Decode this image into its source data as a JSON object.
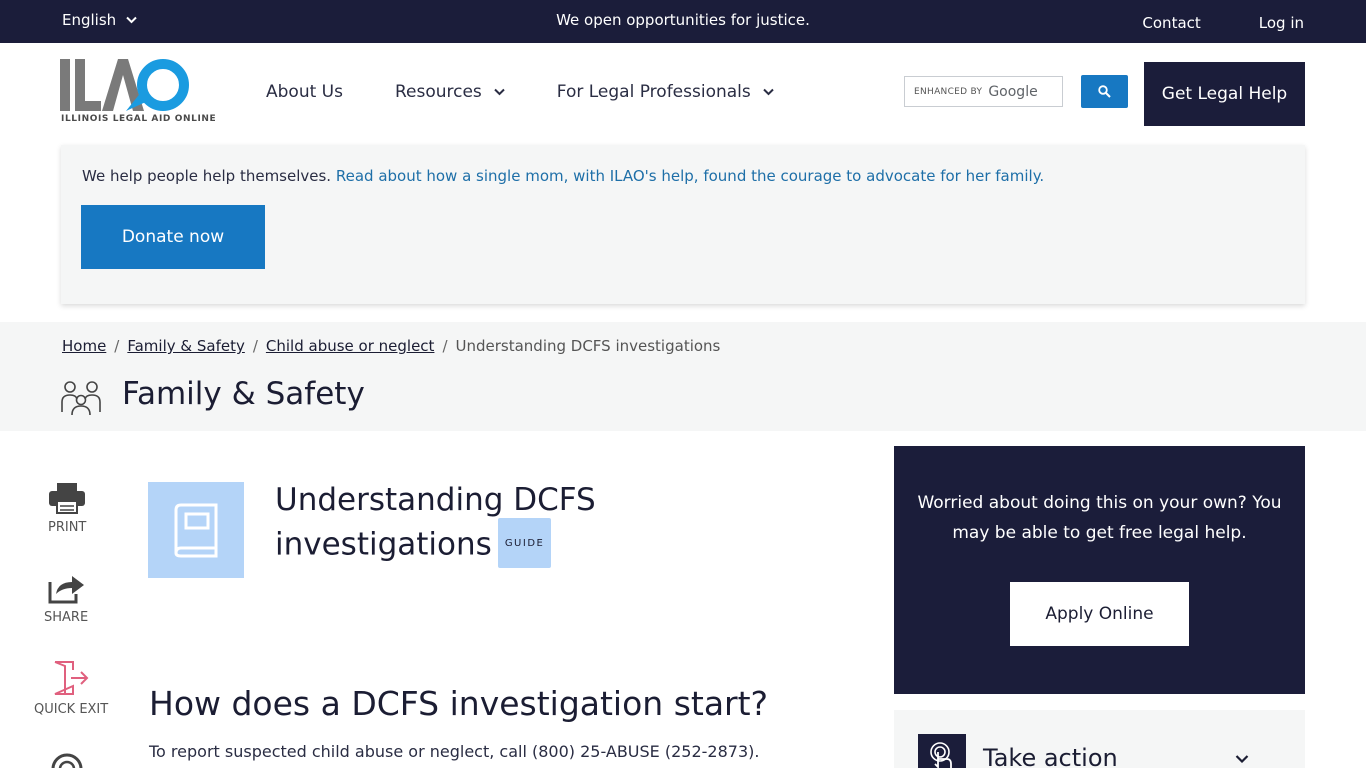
{
  "topbar": {
    "language": "English",
    "tagline": "We open opportunities for justice.",
    "contact": "Contact",
    "login": "Log in"
  },
  "header": {
    "logo_sub": "ILLINOIS LEGAL AID ONLINE",
    "nav": [
      "About Us",
      "Resources",
      "For Legal Professionals"
    ],
    "search_enhanced": "ENHANCED BY",
    "search_brand": "Google",
    "help_button": "Get Legal Help"
  },
  "donate": {
    "intro": "We help people help themselves.",
    "story_link": "Read about how a single mom, with ILAO's help, found the courage to advocate for her family.",
    "button": "Donate now"
  },
  "breadcrumb": {
    "items": [
      "Home",
      "Family & Safety",
      "Child abuse or neglect"
    ],
    "current": "Understanding DCFS investigations"
  },
  "section": {
    "title": "Family & Safety"
  },
  "tools": {
    "print": "PRINT",
    "share": "SHARE",
    "quick_exit": "QUICK EXIT"
  },
  "article": {
    "title": "Understanding DCFS investigations",
    "badge": "GUIDE",
    "h2": "How does a DCFS investigation start?",
    "para": "To report suspected child abuse or neglect, call (800) 25-ABUSE (252-2873)."
  },
  "sidebar": {
    "cta_text": "Worried about doing this on your own?  You may be able to get free legal help.",
    "apply_button": "Apply Online",
    "take_action": "Take action"
  },
  "colors": {
    "navy": "#1b1d3a",
    "blue": "#1778c2",
    "light_blue": "#b4d4f8",
    "exit_pink": "#e0607e"
  }
}
